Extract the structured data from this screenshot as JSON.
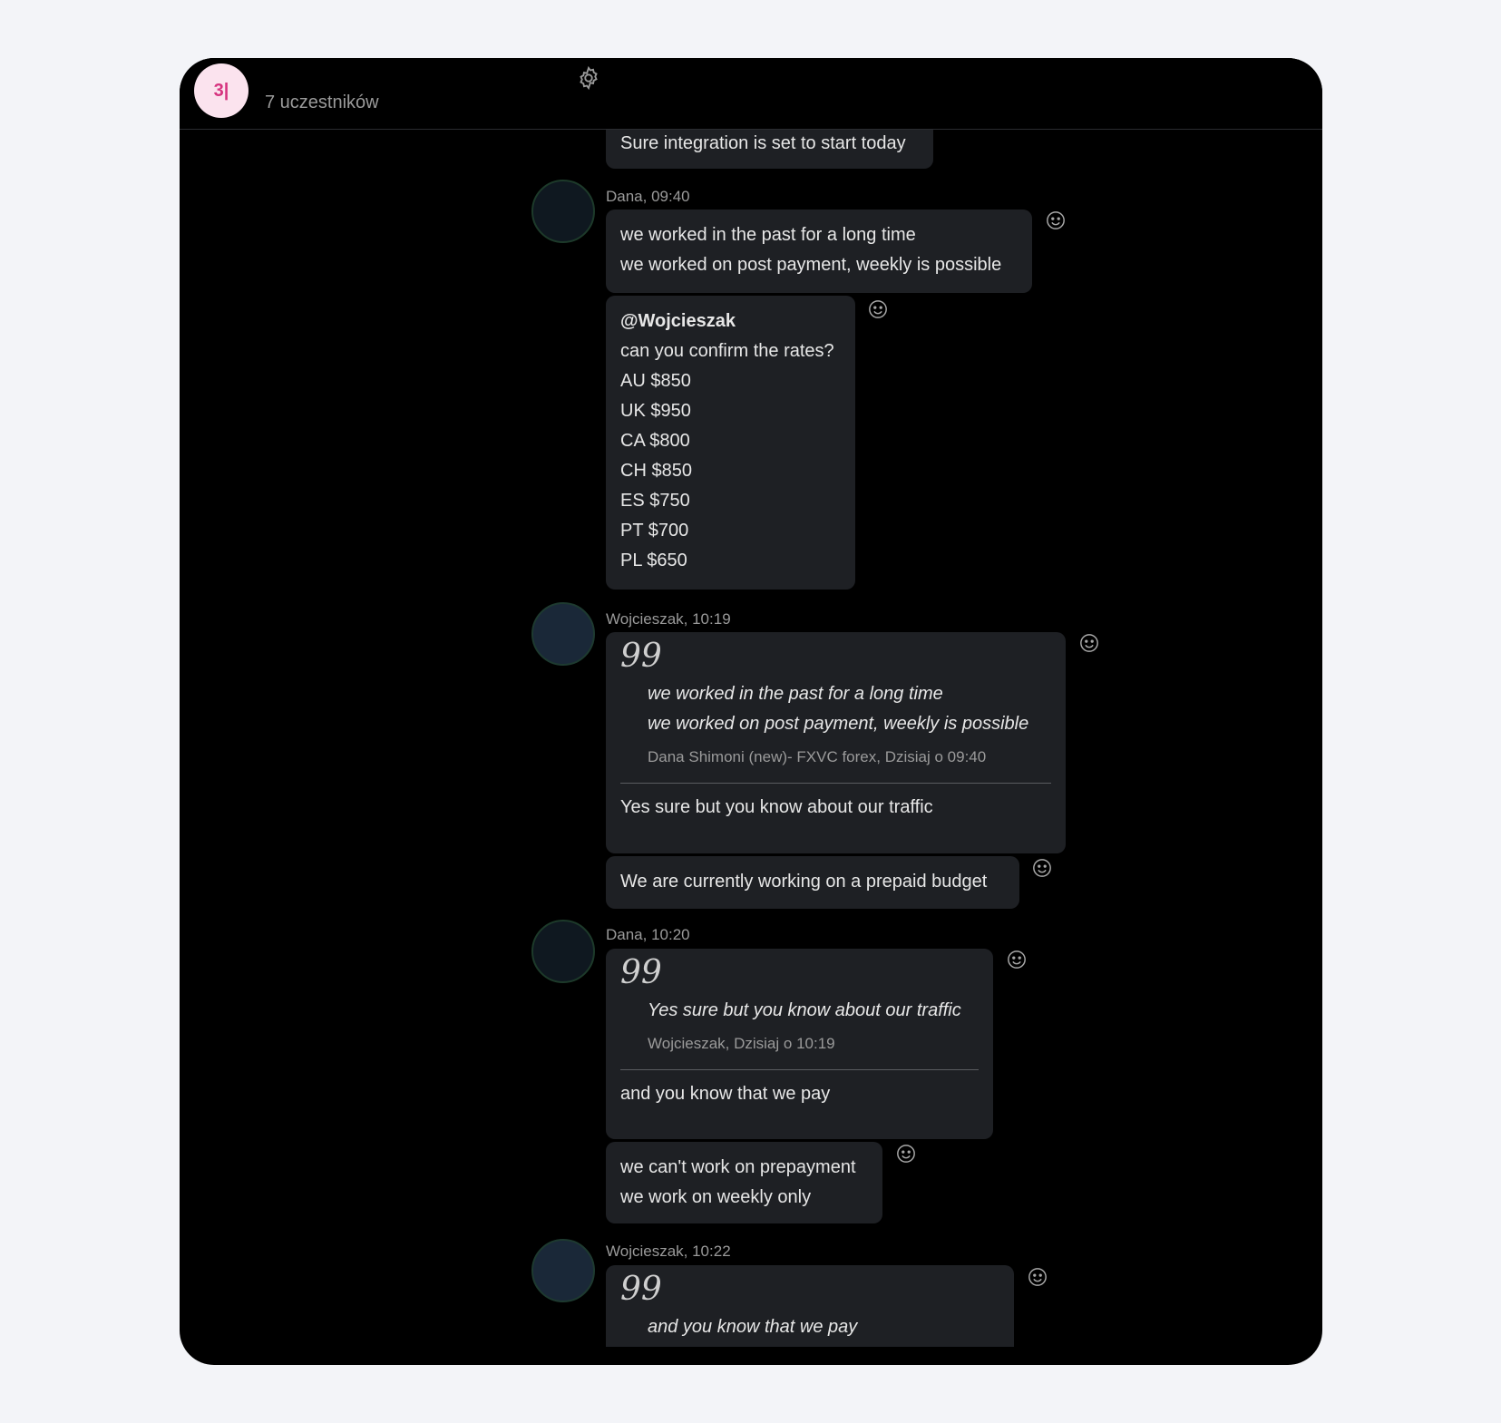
{
  "header": {
    "group_initials": "3|",
    "participants": "7 uczestników"
  },
  "messages": {
    "m0": {
      "lines": [
        "Sure integration is set to start today"
      ]
    },
    "m1": {
      "author_time": "Dana, 09:40",
      "lines": [
        "we worked in the past for a long time",
        "we worked on post payment, weekly is possible"
      ]
    },
    "m2": {
      "mention": "@Wojcieszak",
      "lines": [
        "can you confirm the rates?",
        "AU $850",
        "UK $950",
        "CA $800",
        "CH $850",
        "ES $750",
        "PT $700",
        "PL $650"
      ]
    },
    "m3": {
      "author_time": "Wojcieszak, 10:19",
      "quote_mark": "99",
      "quote_lines": [
        "we worked in the past for a long time",
        "we worked on post payment, weekly is possible"
      ],
      "quote_source": "Dana Shimoni (new)- FXVC forex, Dzisiaj o 09:40",
      "reply": "Yes sure but you know about our traffic"
    },
    "m4": {
      "lines": [
        "We are currently working on a prepaid budget"
      ]
    },
    "m5": {
      "author_time": "Dana, 10:20",
      "quote_mark": "99",
      "quote_lines": [
        "Yes sure but you know about our traffic"
      ],
      "quote_source": "Wojcieszak, Dzisiaj o 10:19",
      "reply": "and you know that we pay"
    },
    "m6": {
      "lines": [
        "we can't work on prepayment",
        "we work on weekly only"
      ]
    },
    "m7": {
      "author_time": "Wojcieszak, 10:22",
      "quote_mark": "99",
      "quote_lines": [
        "and you know that we pay"
      ]
    }
  },
  "icons": {
    "settings": "gear-icon",
    "reaction": "smiley-icon"
  },
  "colors": {
    "background": "#000000",
    "bubble": "#1e2024",
    "accent_avatar": "#d6337f"
  }
}
